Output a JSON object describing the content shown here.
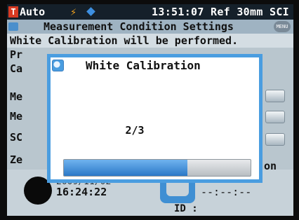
{
  "status": {
    "mode_badge": "T",
    "mode": "Auto",
    "bolt_icon": "lightning-icon",
    "diamond_icon": "diamond-icon",
    "clock_and_ref": "13:51:07 Ref 30mm SCI"
  },
  "header": {
    "title": "Measurement Condition Settings",
    "menu_icon": "MENU"
  },
  "notice": "White Calibration will be performed.",
  "background": {
    "labels": [
      "Pr",
      "Ca",
      "Me",
      "Me",
      "SC",
      "Ze"
    ],
    "on_text": "on",
    "date_partial": "2009/11/02",
    "time": "16:24:22",
    "dashes": "--:--:--",
    "id_label": "ID :"
  },
  "dialog": {
    "title": "White Calibration",
    "step": "2/3",
    "progress_fraction": 0.66
  },
  "colors": {
    "dialog_border": "#4a9de0",
    "progress": "#2a78c7",
    "status_bar": "#15202a",
    "badge": "#d83a22"
  }
}
